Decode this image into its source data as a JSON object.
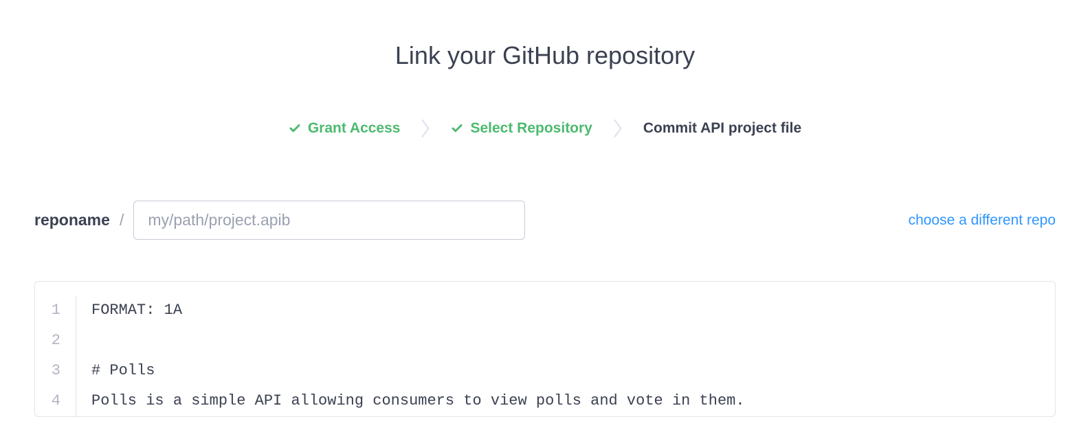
{
  "header": {
    "title": "Link your GitHub repository"
  },
  "stepper": {
    "steps": [
      {
        "label": "Grant Access",
        "state": "completed"
      },
      {
        "label": "Select Repository",
        "state": "completed"
      },
      {
        "label": "Commit API project file",
        "state": "current"
      }
    ]
  },
  "path": {
    "repo_name": "reponame",
    "separator": "/",
    "input_placeholder": "my/path/project.apib",
    "choose_link": "choose a different repo"
  },
  "editor": {
    "lines": [
      {
        "number": "1",
        "content": "FORMAT: 1A"
      },
      {
        "number": "2",
        "content": ""
      },
      {
        "number": "3",
        "content": "# Polls"
      },
      {
        "number": "4",
        "content": "Polls is a simple API allowing consumers to view polls and vote in them."
      }
    ]
  }
}
